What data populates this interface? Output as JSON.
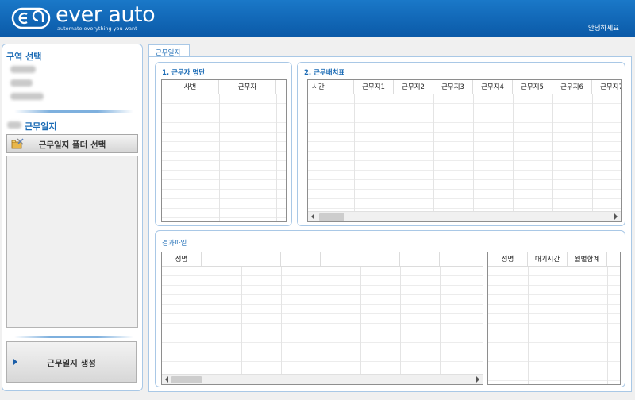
{
  "header": {
    "logo_text": "ever auto",
    "tagline": "automate everything you want",
    "greeting": "안녕하세요"
  },
  "sidebar": {
    "area_title": "구역 선택",
    "worklog_title": "근무일지",
    "folder_button": "근무일지 폴더 선택",
    "generate_button": "근무일지 생성"
  },
  "tab": {
    "label": "근무일지"
  },
  "roster": {
    "title": "1. 근무자 명단",
    "columns": [
      "사번",
      "근무자"
    ]
  },
  "schedule": {
    "title": "2. 근무배치표",
    "columns": [
      "시간",
      "근무지1",
      "근무지2",
      "근무지3",
      "근무지4",
      "근무지5",
      "근무지6",
      "근무지7"
    ]
  },
  "result": {
    "title": "결과파일",
    "main_columns": [
      "성명"
    ],
    "side_columns": [
      "성명",
      "대기시간",
      "월별합계"
    ]
  }
}
